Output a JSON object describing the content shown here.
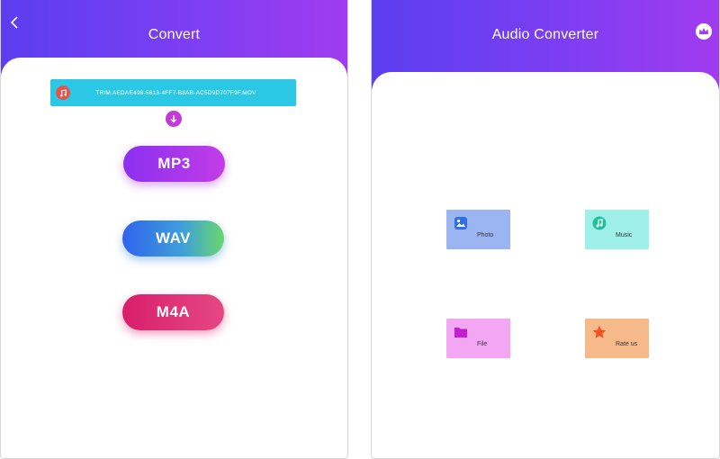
{
  "left_screen": {
    "title": "Convert",
    "back_icon": "chevron-left-icon",
    "file": {
      "name": "TRIM.AEDAE498-5613-4FF7-B8AB-AC5D9D707F9F.MOV",
      "icon": "music-file-icon",
      "bar_color": "#2bc8e6"
    },
    "arrow_icon": "arrow-down-icon",
    "formats": [
      {
        "label": "MP3"
      },
      {
        "label": "WAV"
      },
      {
        "label": "M4A"
      }
    ]
  },
  "right_screen": {
    "title": "Audio Converter",
    "premium_icon": "crown-icon",
    "tiles": [
      {
        "label": "Photo",
        "icon": "image-icon",
        "color": "#9bb4f2"
      },
      {
        "label": "Music",
        "icon": "music-note-icon",
        "color": "#9ef0e8"
      },
      {
        "label": "File",
        "icon": "folder-icon",
        "color": "#f3a6f3"
      },
      {
        "label": "Rate us",
        "icon": "star-icon",
        "color": "#f6b98a"
      }
    ]
  },
  "colors": {
    "header_start": "#5b3ef0",
    "header_end": "#a13bef",
    "mp3_button": "#8b2ff0",
    "wav_button": "#2f64ee",
    "m4a_button": "#d81e6a"
  }
}
